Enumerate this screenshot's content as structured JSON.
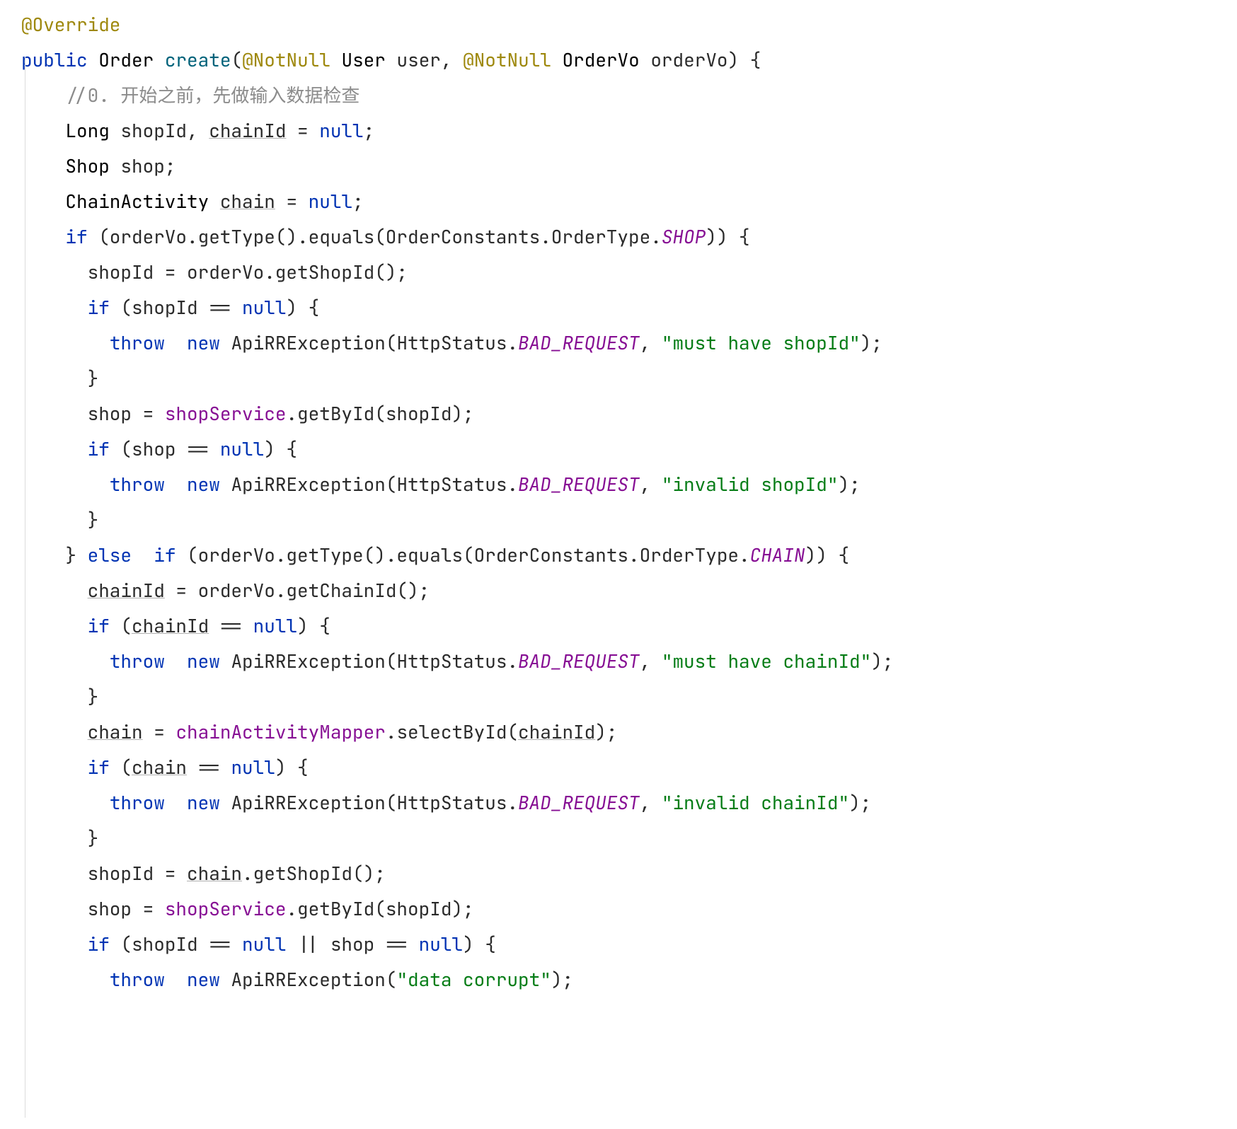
{
  "code": {
    "lines": [
      {
        "indent": 0,
        "tokens": [
          [
            "t-anno",
            "@Override"
          ]
        ]
      },
      {
        "indent": 0,
        "tokens": [
          [
            "t-kw",
            "public"
          ],
          [
            "",
            " "
          ],
          [
            "t-type",
            "Order"
          ],
          [
            "",
            " "
          ],
          [
            "t-method",
            "create"
          ],
          [
            "",
            "("
          ],
          [
            "t-anno",
            "@NotNull"
          ],
          [
            "",
            " "
          ],
          [
            "t-type",
            "User"
          ],
          [
            "",
            " user, "
          ],
          [
            "t-anno",
            "@NotNull"
          ],
          [
            "",
            " "
          ],
          [
            "t-type",
            "OrderVo"
          ],
          [
            "",
            " orderVo) {"
          ]
        ]
      },
      {
        "indent": 0,
        "tokens": [
          [
            "",
            ""
          ]
        ]
      },
      {
        "indent": 2,
        "tokens": [
          [
            "t-cmt",
            "//0. 开始之前，先做输入数据检查"
          ]
        ]
      },
      {
        "indent": 2,
        "tokens": [
          [
            "t-type",
            "Long"
          ],
          [
            "",
            " shopId, "
          ],
          [
            "t-under",
            "chainId"
          ],
          [
            "",
            " = "
          ],
          [
            "t-kw",
            "null"
          ],
          [
            "",
            ";"
          ]
        ]
      },
      {
        "indent": 2,
        "tokens": [
          [
            "t-type",
            "Shop"
          ],
          [
            "",
            " shop;"
          ]
        ]
      },
      {
        "indent": 2,
        "tokens": [
          [
            "t-type",
            "ChainActivity"
          ],
          [
            "",
            " "
          ],
          [
            "t-under",
            "chain"
          ],
          [
            "",
            " = "
          ],
          [
            "t-kw",
            "null"
          ],
          [
            "",
            ";"
          ]
        ]
      },
      {
        "indent": 2,
        "tokens": [
          [
            "t-kw",
            "if"
          ],
          [
            "",
            " (orderVo.getType().equals(OrderConstants.OrderType."
          ],
          [
            "t-enum",
            "SHOP"
          ],
          [
            "",
            ")) {"
          ]
        ]
      },
      {
        "indent": 3,
        "tokens": [
          [
            "",
            "shopId = orderVo.getShopId();"
          ]
        ]
      },
      {
        "indent": 3,
        "tokens": [
          [
            "t-kw",
            "if"
          ],
          [
            "",
            " (shopId == "
          ],
          [
            "t-kw",
            "null"
          ],
          [
            "",
            ") {"
          ]
        ]
      },
      {
        "indent": 4,
        "tokens": [
          [
            "t-kw",
            "throw"
          ],
          [
            "",
            "  "
          ],
          [
            "t-kw",
            "new"
          ],
          [
            "",
            " ApiRRException(HttpStatus."
          ],
          [
            "t-enum",
            "BAD_REQUEST"
          ],
          [
            "",
            ", "
          ],
          [
            "t-str",
            "\"must have shopId\""
          ],
          [
            "",
            ");"
          ]
        ]
      },
      {
        "indent": 3,
        "tokens": [
          [
            "",
            "}"
          ]
        ]
      },
      {
        "indent": 3,
        "tokens": [
          [
            "",
            "shop = "
          ],
          [
            "t-field",
            "shopService"
          ],
          [
            "",
            ".getById(shopId);"
          ]
        ]
      },
      {
        "indent": 3,
        "tokens": [
          [
            "t-kw",
            "if"
          ],
          [
            "",
            " (shop == "
          ],
          [
            "t-kw",
            "null"
          ],
          [
            "",
            ") {"
          ]
        ]
      },
      {
        "indent": 4,
        "tokens": [
          [
            "t-kw",
            "throw"
          ],
          [
            "",
            "  "
          ],
          [
            "t-kw",
            "new"
          ],
          [
            "",
            " ApiRRException(HttpStatus."
          ],
          [
            "t-enum",
            "BAD_REQUEST"
          ],
          [
            "",
            ", "
          ],
          [
            "t-str",
            "\"invalid shopId\""
          ],
          [
            "",
            ");"
          ]
        ]
      },
      {
        "indent": 3,
        "tokens": [
          [
            "",
            "}"
          ]
        ]
      },
      {
        "indent": 2,
        "tokens": [
          [
            "",
            "} "
          ],
          [
            "t-kw",
            "else"
          ],
          [
            "",
            "  "
          ],
          [
            "t-kw",
            "if"
          ],
          [
            "",
            " (orderVo.getType().equals(OrderConstants.OrderType."
          ],
          [
            "t-enum",
            "CHAIN"
          ],
          [
            "",
            ")) {"
          ]
        ]
      },
      {
        "indent": 3,
        "tokens": [
          [
            "t-under",
            "chainId"
          ],
          [
            "",
            " = orderVo.getChainId();"
          ]
        ]
      },
      {
        "indent": 3,
        "tokens": [
          [
            "t-kw",
            "if"
          ],
          [
            "",
            " ("
          ],
          [
            "t-under",
            "chainId"
          ],
          [
            "",
            " == "
          ],
          [
            "t-kw",
            "null"
          ],
          [
            "",
            ") {"
          ]
        ]
      },
      {
        "indent": 4,
        "tokens": [
          [
            "t-kw",
            "throw"
          ],
          [
            "",
            "  "
          ],
          [
            "t-kw",
            "new"
          ],
          [
            "",
            " ApiRRException(HttpStatus."
          ],
          [
            "t-enum",
            "BAD_REQUEST"
          ],
          [
            "",
            ", "
          ],
          [
            "t-str",
            "\"must have chainId\""
          ],
          [
            "",
            ");"
          ]
        ]
      },
      {
        "indent": 3,
        "tokens": [
          [
            "",
            "}"
          ]
        ]
      },
      {
        "indent": 3,
        "tokens": [
          [
            "t-under",
            "chain"
          ],
          [
            "",
            " = "
          ],
          [
            "t-field",
            "chainActivityMapper"
          ],
          [
            "",
            ".selectById("
          ],
          [
            "t-under",
            "chainId"
          ],
          [
            "",
            ");"
          ]
        ]
      },
      {
        "indent": 3,
        "tokens": [
          [
            "t-kw",
            "if"
          ],
          [
            "",
            " ("
          ],
          [
            "t-under",
            "chain"
          ],
          [
            "",
            " == "
          ],
          [
            "t-kw",
            "null"
          ],
          [
            "",
            ") {"
          ]
        ]
      },
      {
        "indent": 4,
        "tokens": [
          [
            "t-kw",
            "throw"
          ],
          [
            "",
            "  "
          ],
          [
            "t-kw",
            "new"
          ],
          [
            "",
            " ApiRRException(HttpStatus."
          ],
          [
            "t-enum",
            "BAD_REQUEST"
          ],
          [
            "",
            ", "
          ],
          [
            "t-str",
            "\"invalid chainId\""
          ],
          [
            "",
            ");"
          ]
        ]
      },
      {
        "indent": 3,
        "tokens": [
          [
            "",
            "}"
          ]
        ]
      },
      {
        "indent": 3,
        "tokens": [
          [
            "",
            "shopId = "
          ],
          [
            "t-under",
            "chain"
          ],
          [
            "",
            ".getShopId();"
          ]
        ]
      },
      {
        "indent": 3,
        "tokens": [
          [
            "",
            "shop = "
          ],
          [
            "t-field",
            "shopService"
          ],
          [
            "",
            ".getById(shopId);"
          ]
        ]
      },
      {
        "indent": 3,
        "tokens": [
          [
            "t-kw",
            "if"
          ],
          [
            "",
            " (shopId == "
          ],
          [
            "t-kw",
            "null"
          ],
          [
            "",
            " || shop == "
          ],
          [
            "t-kw",
            "null"
          ],
          [
            "",
            ") {"
          ]
        ]
      },
      {
        "indent": 4,
        "tokens": [
          [
            "t-kw",
            "throw"
          ],
          [
            "",
            "  "
          ],
          [
            "t-kw",
            "new"
          ],
          [
            "",
            " ApiRRException("
          ],
          [
            "t-str",
            "\"data corrupt\""
          ],
          [
            "",
            ");"
          ]
        ]
      }
    ],
    "indent_unit": "  "
  }
}
